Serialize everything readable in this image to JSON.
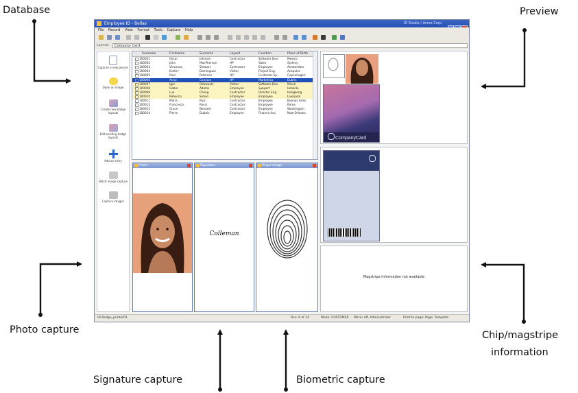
{
  "callouts": {
    "database": "Database",
    "preview": "Preview",
    "photo_capture": "Photo capture",
    "chip_magstripe_line1": "Chip/magstripe",
    "chip_magstripe_line2": "information",
    "signature_capture": "Signature capture",
    "biometric_capture": "Biometric capture"
  },
  "app": {
    "title": "Employee ID - Bellas",
    "title_right": "ID Studio / Acme Corp",
    "menu": [
      "File",
      "Record",
      "View",
      "Format",
      "Tools",
      "Capture",
      "Help"
    ],
    "address_label": "Layout:",
    "address_value": "Company Card",
    "tasks": [
      {
        "label": "Capture a new person"
      },
      {
        "label": "Open an image"
      },
      {
        "label": "Create new badge layouts"
      },
      {
        "label": "Edit existing badge layouts"
      },
      {
        "label": "Add an entry"
      },
      {
        "label": "Batch image capture"
      },
      {
        "label": "Capture images"
      }
    ],
    "db_columns": [
      "Surname",
      "Firstname",
      "Surname",
      "Layout",
      "Function",
      "Place of Birth"
    ],
    "db_rows": [
      [
        "100001",
        "Oscar",
        "Johnson",
        "Contractor",
        "Software Dev.",
        "Mexico"
      ],
      [
        "100002",
        "John",
        "MacPherson",
        "HP",
        "Sales",
        "Sydney"
      ],
      [
        "100003",
        "Vincenzo",
        "Stewart",
        "Contractor",
        "Employee",
        "Amsterdam"
      ],
      [
        "100004",
        "Esther",
        "Dominguez",
        "Visitor",
        "Project Eng.",
        "Acapulco"
      ],
      [
        "100005",
        "Paul",
        "Peterson",
        "HP",
        "Customer Sp.",
        "Copenhagen"
      ],
      [
        "100006",
        "Anna",
        "Connors",
        "HP",
        "Marketing",
        "Dublin"
      ],
      [
        "100007",
        "Igor",
        "Ostrowski",
        "Visitor",
        "Software Dev.",
        "Minsk"
      ],
      [
        "100008",
        "Gabor",
        "Adams",
        "Employee",
        "Support",
        "Helsinki"
      ],
      [
        "100009",
        "Luo",
        "Cheng",
        "Contractor",
        "Director Eng.",
        "Hongkong"
      ],
      [
        "100010",
        "Rebecca",
        "Simon",
        "Employee",
        "Employee",
        "Liverpool"
      ],
      [
        "100011",
        "Maria",
        "Ruiz",
        "Contractor",
        "Employee",
        "Buenos Aires"
      ],
      [
        "100012",
        "Francesco",
        "Rossi",
        "Contractor",
        "Employee",
        "Rome"
      ],
      [
        "100013",
        "Grace",
        "Bennett",
        "Contractor",
        "Employee",
        "Washington"
      ],
      [
        "100014",
        "Pierre",
        "Dubois",
        "Employee",
        "Finance Acc.",
        "New Orleans"
      ]
    ],
    "capture_panels": [
      "Photo",
      "Signature",
      "Finger image"
    ],
    "signature_text": "Colleman",
    "card_logo": "CompanyCard",
    "magstripe_message": "Magstripe information not available",
    "status": {
      "left": "ID Badge_printer01",
      "mid": "Rec: 6 of 14",
      "right1": "Mode: CUSTOMER",
      "right2": "Mirror off, Administrator",
      "right3": "Print to page: Page: Template"
    }
  }
}
